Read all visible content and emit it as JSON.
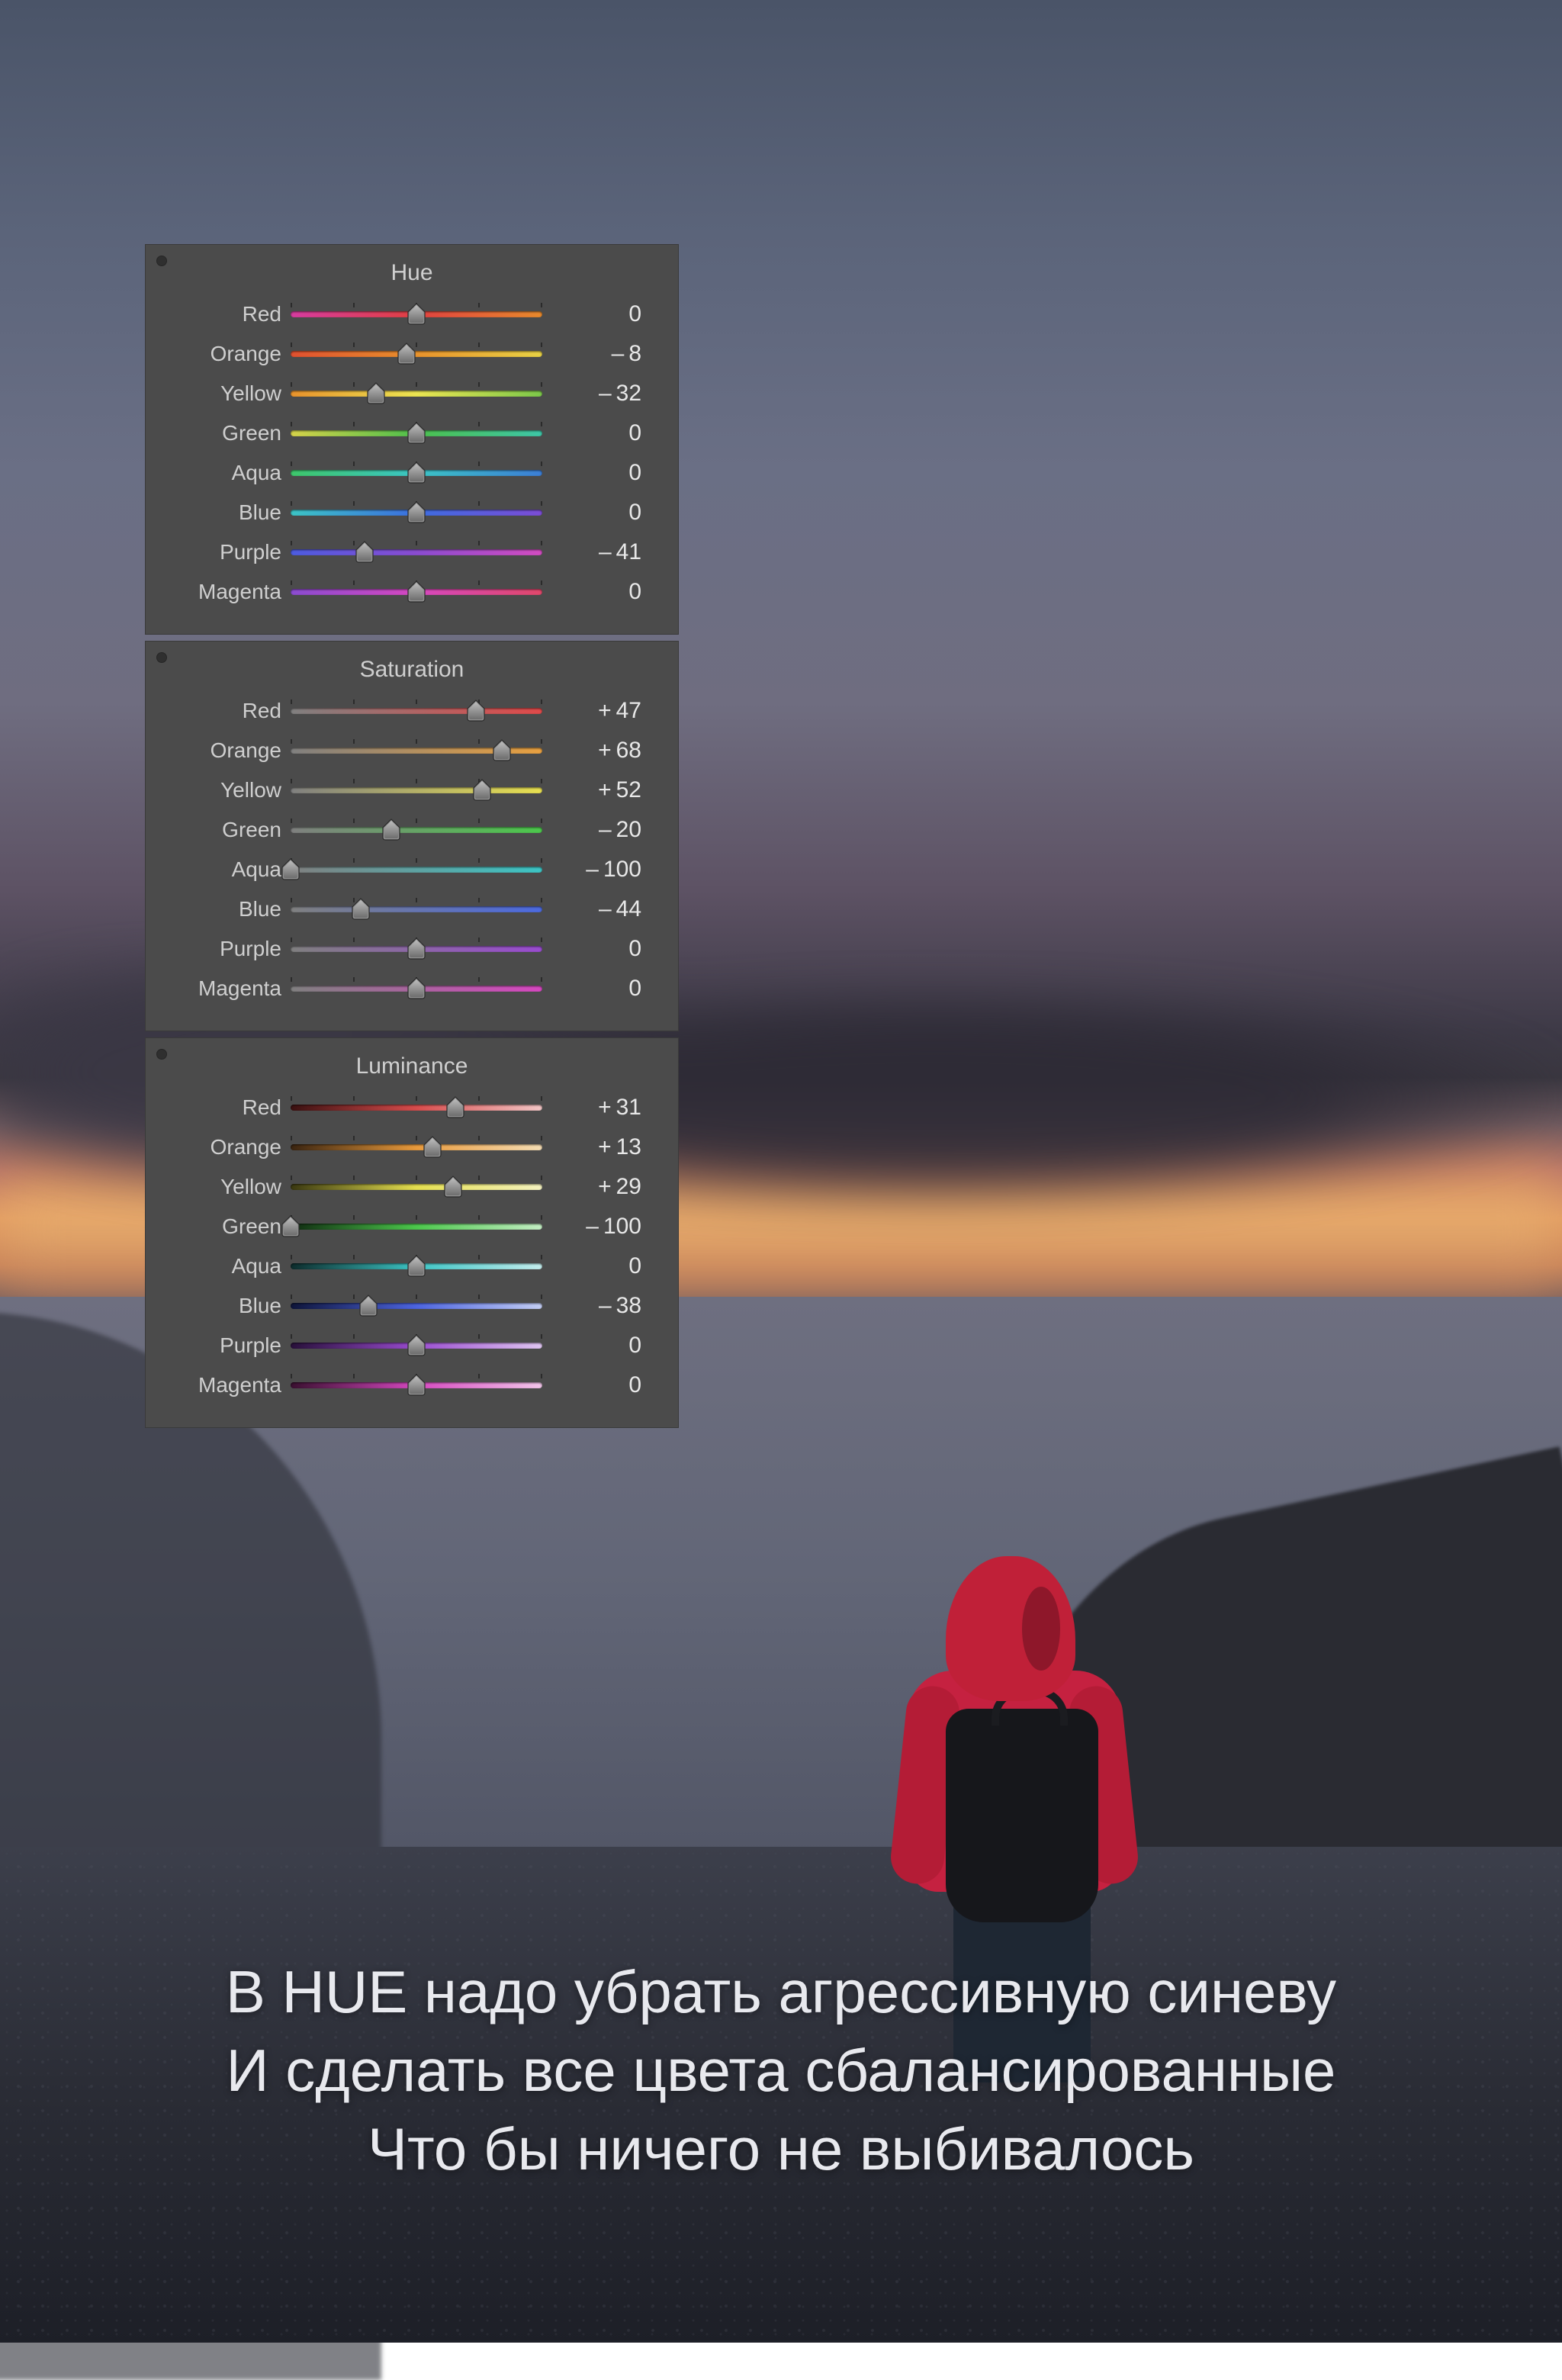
{
  "colors_order": [
    "red",
    "orange",
    "yellow",
    "green",
    "aqua",
    "blue",
    "purple",
    "magenta"
  ],
  "labels": {
    "red": "Red",
    "orange": "Orange",
    "yellow": "Yellow",
    "green": "Green",
    "aqua": "Aqua",
    "blue": "Blue",
    "purple": "Purple",
    "magenta": "Magenta"
  },
  "panels": [
    {
      "id": "hue",
      "title": "Hue",
      "values": {
        "red": 0,
        "orange": -8,
        "yellow": -32,
        "green": 0,
        "aqua": 0,
        "blue": 0,
        "purple": -41,
        "magenta": 0
      }
    },
    {
      "id": "saturation",
      "title": "Saturation",
      "values": {
        "red": 47,
        "orange": 68,
        "yellow": 52,
        "green": -20,
        "aqua": -100,
        "blue": -44,
        "purple": 0,
        "magenta": 0
      }
    },
    {
      "id": "luminance",
      "title": "Luminance",
      "values": {
        "red": 31,
        "orange": 13,
        "yellow": 29,
        "green": -100,
        "aqua": 0,
        "blue": -38,
        "purple": 0,
        "magenta": 0
      }
    }
  ],
  "gradients": {
    "hue": {
      "red": [
        "#d63ca0",
        "#e04040",
        "#e88a2c"
      ],
      "orange": [
        "#e05030",
        "#e8922c",
        "#e8d245"
      ],
      "yellow": [
        "#e8922c",
        "#ece552",
        "#7cc84a"
      ],
      "green": [
        "#d6d24a",
        "#4cbf4c",
        "#3ec6a8"
      ],
      "aqua": [
        "#3ec66a",
        "#3cc5c5",
        "#3c7ed6"
      ],
      "blue": [
        "#3cc5c5",
        "#3c6de0",
        "#7c4cd6"
      ],
      "purple": [
        "#4c5ce0",
        "#8a4cd0",
        "#d24cc0"
      ],
      "magenta": [
        "#8a4cd0",
        "#d648c0",
        "#e0486a"
      ]
    },
    "saturation": {
      "red": [
        "#808080",
        "#e04a4a"
      ],
      "orange": [
        "#808080",
        "#e8a040"
      ],
      "yellow": [
        "#808080",
        "#e8e050"
      ],
      "green": [
        "#808080",
        "#4cc84c"
      ],
      "aqua": [
        "#808080",
        "#3cc5c5"
      ],
      "blue": [
        "#808080",
        "#4c6ae0"
      ],
      "purple": [
        "#808080",
        "#9a4cd0"
      ],
      "magenta": [
        "#808080",
        "#d648c0"
      ]
    },
    "luminance": {
      "red": [
        "#3a1010",
        "#d84c4c",
        "#f2c6c6"
      ],
      "orange": [
        "#3a2410",
        "#e89a3c",
        "#f5ddb4"
      ],
      "yellow": [
        "#3a3810",
        "#e6e050",
        "#f4f2c0"
      ],
      "green": [
        "#0f2a10",
        "#4cc84c",
        "#c4eec4"
      ],
      "aqua": [
        "#0d2c2c",
        "#3cc5c5",
        "#c4eded"
      ],
      "blue": [
        "#0e153a",
        "#4c64e0",
        "#c4cef4"
      ],
      "purple": [
        "#28103a",
        "#9a4cd0",
        "#e0c6f2"
      ],
      "magenta": [
        "#3a1030",
        "#d648c0",
        "#f2c6ea"
      ]
    }
  },
  "caption": {
    "line1": "В HUE надо убрать агрессивную синеву",
    "line2": "И сделать все цвета сбалансированные",
    "line3": "Что бы ничего не выбивалось"
  }
}
